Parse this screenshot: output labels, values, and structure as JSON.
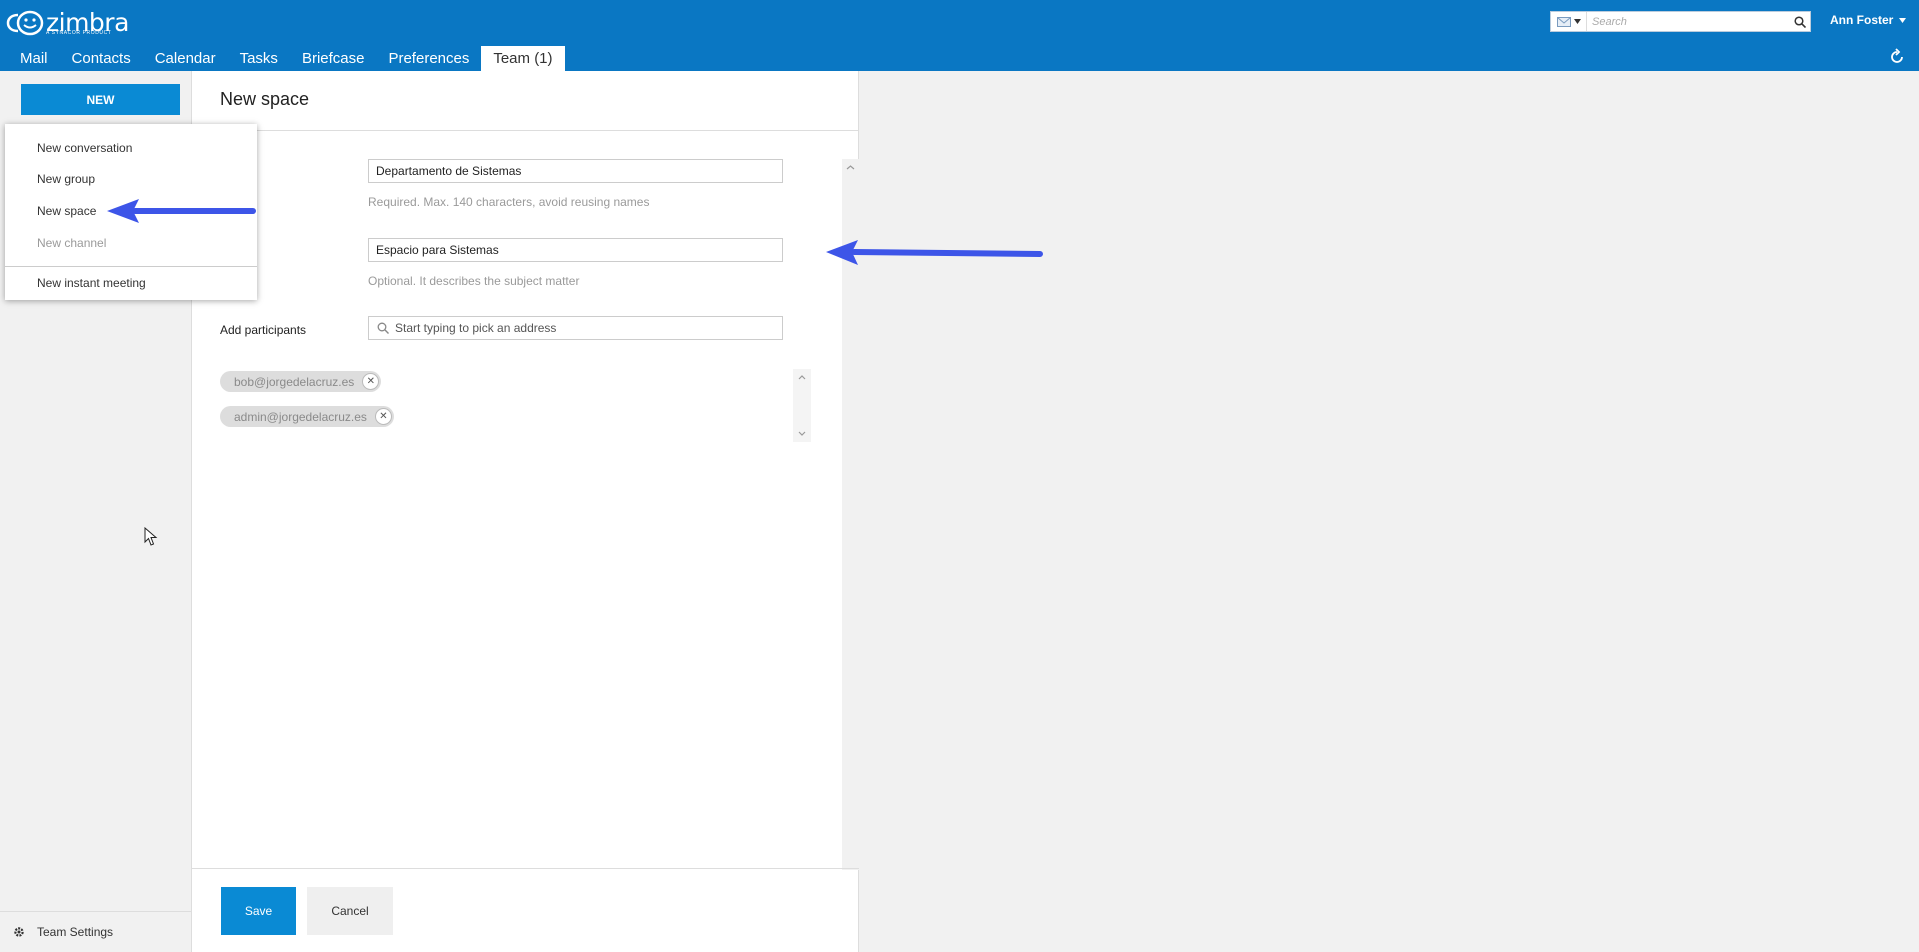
{
  "app": {
    "brand": "zimbra",
    "brand_sub": "A SYNACOR PRODUCT"
  },
  "header": {
    "search_placeholder": "Search",
    "user_name": "Ann Foster",
    "tabs": [
      {
        "label": "Mail"
      },
      {
        "label": "Contacts"
      },
      {
        "label": "Calendar"
      },
      {
        "label": "Tasks"
      },
      {
        "label": "Briefcase"
      },
      {
        "label": "Preferences"
      },
      {
        "label": "Team (1)",
        "active": true
      }
    ]
  },
  "sidebar": {
    "new_label": "NEW",
    "settings_label": "Team Settings"
  },
  "menu": {
    "items": [
      {
        "label": "New conversation",
        "enabled": true
      },
      {
        "label": "New group",
        "enabled": true
      },
      {
        "label": "New space",
        "enabled": true
      },
      {
        "label": "New channel",
        "enabled": false
      },
      {
        "label": "New instant meeting",
        "enabled": true
      }
    ]
  },
  "form": {
    "title": "New space",
    "name_value": "Departamento de Sistemas",
    "name_hint": "Required. Max. 140 characters, avoid reusing names",
    "description_value": "Espacio para Sistemas",
    "description_hint": "Optional. It describes the subject matter",
    "participants_label": "Add participants",
    "participants_placeholder": "Start typing to pick an address",
    "participants": [
      "bob@jorgedelacruz.es",
      "admin@jorgedelacruz.es"
    ],
    "save_label": "Save",
    "cancel_label": "Cancel"
  },
  "colors": {
    "brand_blue": "#0a77c3",
    "button_blue": "#0a8ad4",
    "annotation_arrow": "#3d55e8"
  }
}
